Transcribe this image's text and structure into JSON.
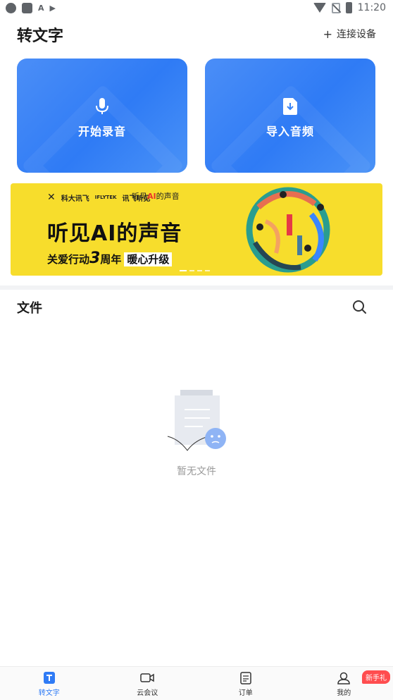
{
  "statusbar": {
    "time": "11:20",
    "left_glyphs": [
      "A",
      "▶"
    ]
  },
  "header": {
    "title": "转文字",
    "connect_plus": "+",
    "connect_label": "连接设备"
  },
  "actions": [
    {
      "label": "开始录音",
      "icon": "microphone-icon"
    },
    {
      "label": "导入音频",
      "icon": "import-file-icon"
    }
  ],
  "banner": {
    "brand_1": "科大讯飞",
    "brand_1_sub": "IFLYTEK",
    "brand_2": "讯飞听见",
    "sub_brand_prefix": "听见",
    "sub_brand_ai": "AI",
    "sub_brand_suffix": "的声音",
    "headline": "听见AI的声音",
    "tagline_prefix": "关爱行动",
    "tagline_num": "3",
    "tagline_mid": "周年",
    "tagline_pill": "暖心升级",
    "page_count": 4,
    "active_page": 0
  },
  "files": {
    "title": "文件",
    "empty_text": "暂无文件"
  },
  "colors": {
    "accent": "#2f7bf5",
    "banner_bg": "#f7dd2c",
    "badge": "#ff4d4f"
  },
  "bottom_nav": {
    "items": [
      {
        "label": "转文字",
        "icon": "text-t-icon",
        "active": true
      },
      {
        "label": "云会议",
        "icon": "video-camera-icon",
        "active": false
      },
      {
        "label": "订单",
        "icon": "clipboard-icon",
        "active": false
      },
      {
        "label": "我的",
        "icon": "user-icon",
        "active": false
      }
    ],
    "badge": "新手礼"
  }
}
